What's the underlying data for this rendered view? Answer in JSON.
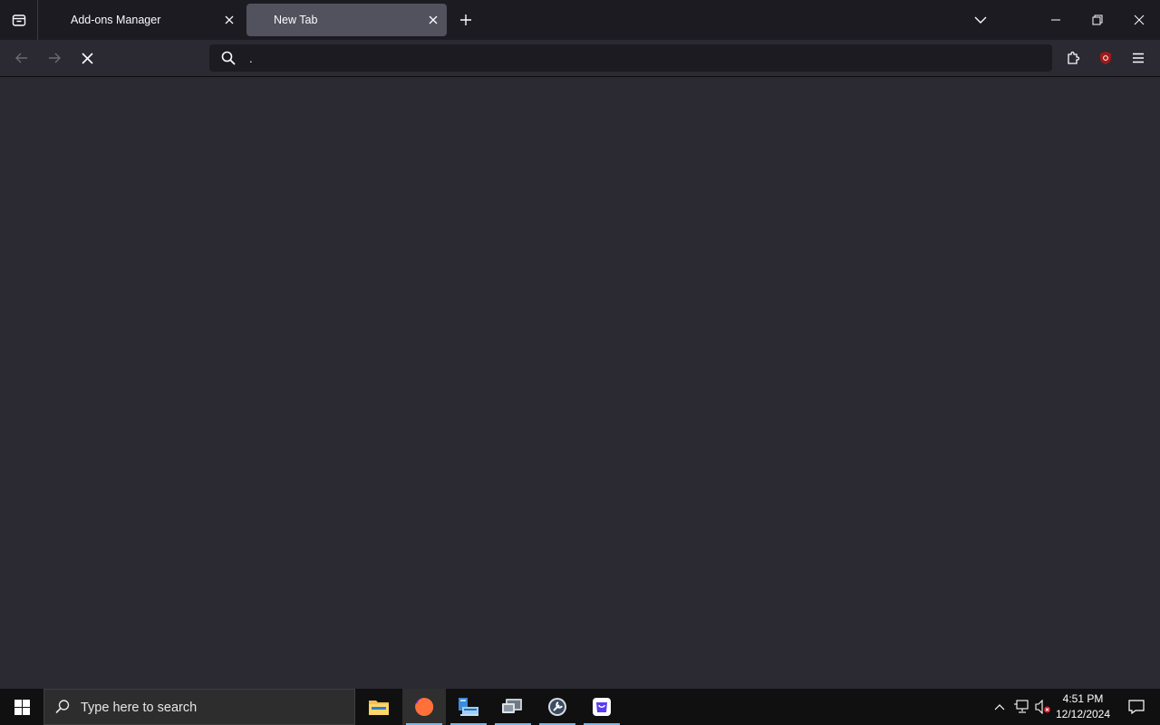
{
  "browser": {
    "tabs": [
      {
        "label": "Add-ons Manager",
        "selected": false
      },
      {
        "label": "New Tab",
        "selected": true
      }
    ],
    "urlbar": {
      "value": "."
    }
  },
  "taskbar": {
    "search_placeholder": "Type here to search",
    "clock": {
      "time": "4:51 PM",
      "date": "12/12/2024"
    }
  },
  "colors": {
    "tabstrip_bg": "#1c1b22",
    "toolbar_bg": "#2b2a33",
    "selected_tab_bg": "#52525e",
    "taskbar_bg": "#101010",
    "ublock_red": "#a01a1a"
  }
}
